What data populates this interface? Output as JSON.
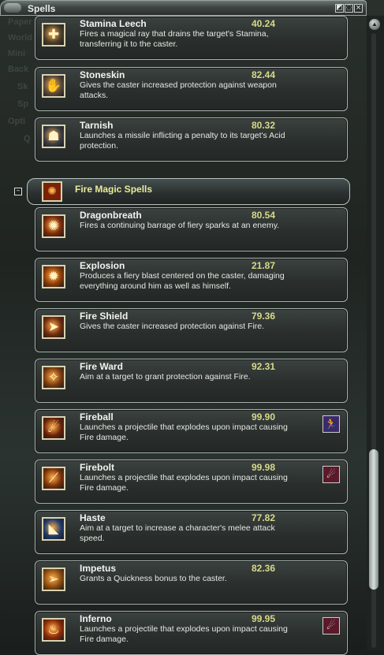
{
  "window": {
    "title": "Spells",
    "min_glyph": "◩",
    "restore_glyph": "◌",
    "close_glyph": "×"
  },
  "background_labels": [
    "Paper",
    "World",
    "Mini",
    "Back",
    "Sk",
    "Sp",
    "Opti",
    "Q"
  ],
  "spells_top": [
    {
      "name": "Stamina Leech",
      "value": "40.24",
      "desc": "Fires a magical ray that drains the target's Stamina, transferring it to the caster.",
      "icon": "stamina-leech-icon",
      "glyph": "✚",
      "bg": "#4a3f2a"
    },
    {
      "name": "Stoneskin",
      "value": "82.44",
      "desc": "Gives the caster increased protection against weapon attacks.",
      "icon": "stoneskin-icon",
      "glyph": "✋",
      "bg": "#5a4a3a"
    },
    {
      "name": "Tarnish",
      "value": "80.32",
      "desc": "Launches a missile inflicting a penalty to its target's Acid protection.",
      "icon": "tarnish-icon",
      "glyph": "☗",
      "bg": "#3b3d44"
    }
  ],
  "category": {
    "label": "Fire Magic Spells",
    "collapse_glyph": "–"
  },
  "spells_fire": [
    {
      "name": "Dragonbreath",
      "value": "80.54",
      "desc": "Fires a continuing barrage of fiery sparks at an enemy.",
      "icon": "dragonbreath-icon",
      "glyph": "✺",
      "bg": "#7a2a0a"
    },
    {
      "name": "Explosion",
      "value": "21.87",
      "desc": "Produces a fiery blast centered on the caster, damaging everything around him as well as himself.",
      "icon": "explosion-icon",
      "glyph": "✹",
      "bg": "#8a3a08"
    },
    {
      "name": "Fire Shield",
      "value": "79.36",
      "desc": "Gives the caster increased protection against Fire.",
      "icon": "fire-shield-icon",
      "glyph": "➤",
      "bg": "#6e2a10"
    },
    {
      "name": "Fire Ward",
      "value": "92.31",
      "desc": "Aim at a target to grant protection against Fire.",
      "icon": "fire-ward-icon",
      "glyph": "✧",
      "bg": "#7a3a10"
    },
    {
      "name": "Fireball",
      "value": "99.90",
      "desc": "Launches a projectile that explodes upon impact causing Fire damage.",
      "icon": "fireball-icon",
      "glyph": "☄",
      "bg": "#6a2008",
      "hotkey": {
        "icon": "running-man-icon",
        "glyph": "🏃",
        "bg": "#3a2a6a"
      }
    },
    {
      "name": "Firebolt",
      "value": "99.98",
      "desc": "Launches a projectile that explodes upon impact causing Fire damage.",
      "icon": "firebolt-icon",
      "glyph": "⟋",
      "bg": "#7a3008",
      "hotkey": {
        "icon": "comet-icon",
        "glyph": "☄",
        "bg": "#5a1a2a"
      }
    },
    {
      "name": "Haste",
      "value": "77.82",
      "desc": "Aim at a target to increase a character's melee attack speed.",
      "icon": "haste-icon",
      "glyph": "◣",
      "bg": "#1e3a6a"
    },
    {
      "name": "Impetus",
      "value": "82.36",
      "desc": "Grants a Quickness bonus to the caster.",
      "icon": "impetus-icon",
      "glyph": "➢",
      "bg": "#8a4a10"
    },
    {
      "name": "Inferno",
      "value": "99.95",
      "desc": "Launches a projectile that explodes upon impact causing Fire damage.",
      "icon": "inferno-icon",
      "glyph": "♨",
      "bg": "#8a2a08",
      "hotkey": {
        "icon": "comet-icon",
        "glyph": "☄",
        "bg": "#5a1a2a"
      }
    }
  ]
}
